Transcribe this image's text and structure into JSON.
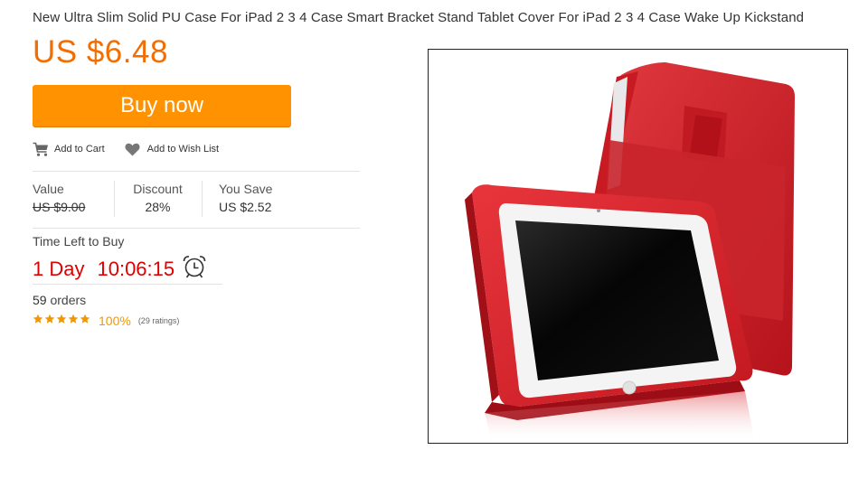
{
  "product": {
    "title": "New Ultra Slim Solid PU Case For iPad 2 3 4 Case Smart Bracket Stand Tablet Cover For iPad 2 3 4 Case Wake Up Kickstand",
    "price": "US $6.48"
  },
  "buy_now_label": "Buy now",
  "actions": {
    "add_to_cart": "Add to Cart",
    "add_to_wishlist": "Add to Wish List"
  },
  "pricing": {
    "value_label": "Value",
    "value": "US $9.00",
    "discount_label": "Discount",
    "discount": "28%",
    "save_label": "You Save",
    "save": "US $2.52"
  },
  "timer": {
    "label": "Time Left to Buy",
    "days": "1 Day",
    "time": "10:06:15"
  },
  "orders": {
    "count": "59",
    "label": "orders"
  },
  "rating": {
    "stars": 5,
    "percent": "100%",
    "count_text": "(29 ratings)"
  },
  "colors": {
    "accent": "#f36d00",
    "button": "#ff9200",
    "timer": "#e00000",
    "stars": "#f39700",
    "case": "#d8222b"
  },
  "icons": {
    "cart": "cart-icon",
    "heart": "heart-icon",
    "alarm": "alarm-clock-icon",
    "star": "star-icon"
  }
}
